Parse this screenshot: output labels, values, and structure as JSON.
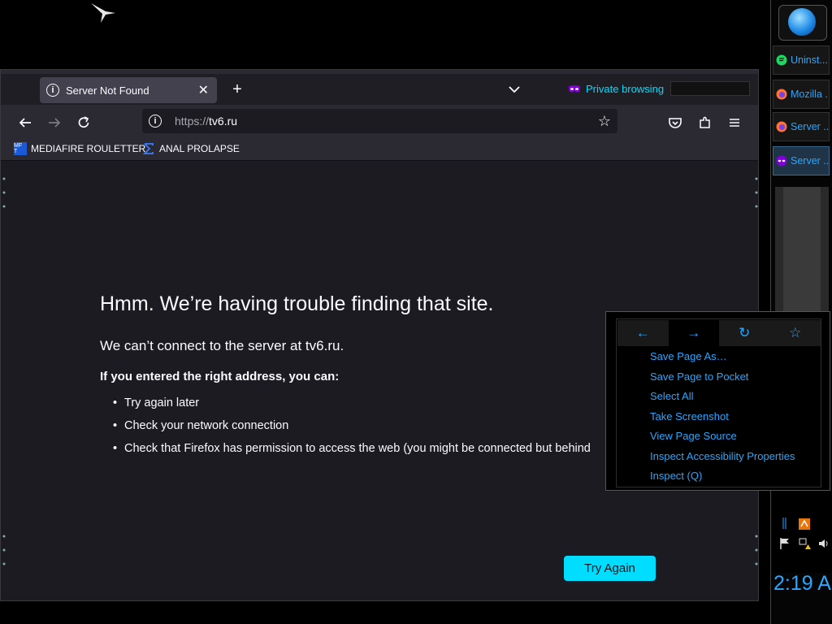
{
  "browser": {
    "tab": {
      "title": "Server Not Found"
    },
    "private_label": "Private browsing",
    "url": {
      "scheme": "https://",
      "host": "tv6.ru"
    },
    "bookmarks": [
      {
        "label": "MEDIAFIRE ROULETTER",
        "icon": "mediafire-icon",
        "icon_text": "MF T"
      },
      {
        "label": "ANAL PROLAPSE",
        "icon": "sigma-icon"
      }
    ]
  },
  "error_page": {
    "title": "Hmm. We’re having trouble finding that site.",
    "subtitle": "We can’t connect to the server at tv6.ru.",
    "instructions": "If you entered the right address, you can:",
    "tips": [
      "Try again later",
      "Check your network connection",
      "Check that Firefox has permission to access the web (you might be connected but behind"
    ],
    "try_again_label": "Try Again"
  },
  "context_menu": {
    "nav": [
      "←",
      "→",
      "↻",
      "☆"
    ],
    "items": [
      "Save Page As…",
      "Save Page to Pocket",
      "Select All",
      "Take Screenshot",
      "View Page Source",
      "Inspect Accessibility Properties",
      "Inspect (Q)"
    ]
  },
  "taskbar": {
    "items": [
      {
        "label": "Uninst...",
        "icon": "chat-icon"
      },
      {
        "label": "Mozilla ...",
        "icon": "firefox-icon"
      },
      {
        "label": "Server ...",
        "icon": "firefox-icon"
      },
      {
        "label": "Server ...",
        "icon": "private-mask-icon",
        "active": true
      }
    ],
    "clock": "2:19 A"
  },
  "colors": {
    "accent": "#00ddff",
    "taskbar_text": "#2aa7ff",
    "private_purple": "#8000d7",
    "page_bg": "#1c1b22"
  }
}
